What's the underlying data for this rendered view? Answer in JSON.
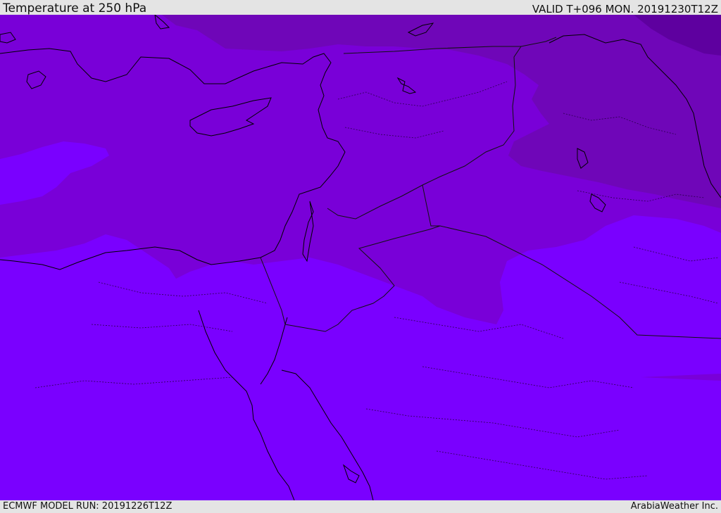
{
  "header": {
    "title": "Temperature at 250 hPa",
    "valid": "VALID T+096 MON. 20191230T12Z"
  },
  "footer": {
    "model_run": "ECMWF MODEL RUN: 20191226T12Z",
    "credit": "ArabiaWeather Inc."
  },
  "colors": {
    "band_coldest": "#5e009f",
    "band_cold": "#6f06b8",
    "band_mid": "#7900d8",
    "band_warm": "#7a00ff",
    "coastline": "#000000",
    "border": "#1a0033"
  }
}
